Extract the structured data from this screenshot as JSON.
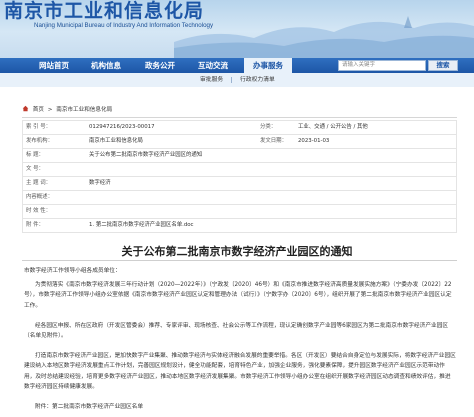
{
  "header": {
    "title": "南京市工业和信息化局",
    "subtitle": "Nanjing Municipal Bureau of Industry And Information Technology"
  },
  "nav": {
    "items": [
      {
        "label": "网站首页"
      },
      {
        "label": "机构信息"
      },
      {
        "label": "政务公开"
      },
      {
        "label": "互动交流"
      },
      {
        "label": "办事服务"
      }
    ],
    "active_index": 4,
    "search": {
      "placeholder": "请输入关键字",
      "button": "搜索"
    }
  },
  "subnav": {
    "items": [
      {
        "label": "审批服务"
      },
      {
        "label": "行政权力清单"
      }
    ]
  },
  "breadcrumb": {
    "home": "首页",
    "separator": ">",
    "current": "南京市工业和信息化局"
  },
  "info": {
    "index_label": "索 引 号：",
    "index_value": "012947216/2023-00017",
    "category_label": "分类：",
    "category_value": "工业、交通 / 公开公告 / 其他",
    "publisher_label": "发布机构：",
    "publisher_value": "南京市工业和信息化局",
    "date_label": "发文日期：",
    "date_value": "2023-01-03",
    "title_label": "标    题：",
    "title_value": "关于公布第二批南京市数字经济产业园区的通知",
    "docno_label": "文    号：",
    "docno_value": "",
    "keywords_label": "主 题 词：",
    "keywords_value": "数字经济",
    "content_label": "内容概述：",
    "content_value": "",
    "effect_label": "时 效 性：",
    "effect_value": "",
    "attach_label": "附    件：",
    "attach_value": "1. 第二批南京市数字经济产业园区名单.doc"
  },
  "article": {
    "title": "关于公布第二批南京市数字经济产业园区的通知",
    "paragraphs": [
      "市数字经济工作领导小组各成员单位：",
      "为贯彻落实《南京市数字经济发展三年行动计划（2020—2022年）》（宁政发〔2020〕46号）和《南京市推进数字经济高质量发展实施方案》（宁委办发〔2022〕22号），市数字经济工作领导小组办公室依据《南京市数字经济产业园区认定和管理办法（试行）》（宁数字办〔2020〕6号），组织开展了第二批南京市数字经济产业园区认定工作。",
      "经各园区申报、所在区政府（开发区管委会）推荐、专家评审、现场核查、社会公示等工作流程，现认定确创数字产业园等6家园区为第二批南京市数字经济产业园区（名单见附件）。",
      "打造南京市数字经济产业园区，是加快数字产业集聚、推动数字经济与实体经济融合发展的重要举措。各区（开发区）要结合自身定位与发展实际，将数字经济产业园区建设纳入本地区数字经济发展重点工作计划，完善园区规划设计，健全功能配套，培育特色产业，加强企业服务，强化要素保障，提升园区数字经济产业园区示范带动作用，及时总结建设经验，培育更多数字经济产业园区，推动本地区数字经济发展集聚。市数字经济工作领导小组办公室在组织开展数字经济园区动态调查和绩效评估，推进数字经济园区持续健康发展。",
      "附件：第二批南京市数字经济产业园区名单"
    ]
  },
  "colors": {
    "brand_blue": "#1d56a6",
    "subnav_bg": "#e8f1fa"
  },
  "icons": [
    "home-icon",
    "search-icon"
  ]
}
